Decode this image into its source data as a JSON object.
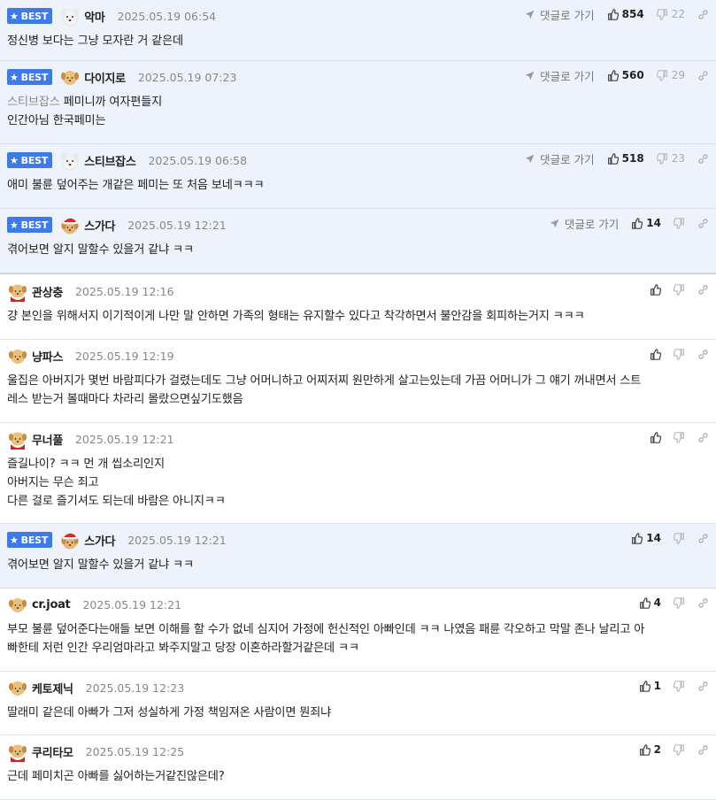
{
  "labels": {
    "best": "BEST",
    "reply_link": "댓글로 가기"
  },
  "colors": {
    "best_badge": "#3f7be6",
    "best_row_bg": "#eef3fb"
  },
  "comments": [
    {
      "best": true,
      "avatar": "white-dog",
      "nick": "악마",
      "date": "2025.05.19 06:54",
      "up": "854",
      "down": "22",
      "lines": [
        "정신병 보다는 그냥 모자란 거 같은데"
      ]
    },
    {
      "best": true,
      "avatar": "golden-dog",
      "nick": "다이지로",
      "date": "2025.05.19 07:23",
      "up": "560",
      "down": "29",
      "mention": "스티브잡스",
      "lines": [
        " 페미니까 여자편들지",
        "인간아님 한국페미는"
      ]
    },
    {
      "best": true,
      "avatar": "white-dog",
      "nick": "스티브잡스",
      "date": "2025.05.19 06:58",
      "up": "518",
      "down": "23",
      "lines": [
        "애미 불륜 덮어주는 개같은 페미는 또 처음 보네ㅋㅋㅋ"
      ]
    },
    {
      "best": true,
      "avatar": "santa-dog",
      "nick": "스가다",
      "date": "2025.05.19 12:21",
      "up": "14",
      "down": "",
      "lines": [
        "겪어보면 알지 말할수 있을거 같냐 ㅋㅋ"
      ]
    },
    {
      "best": false,
      "avatar": "cape-dog",
      "nick": "관상충",
      "date": "2025.05.19 12:16",
      "up": "",
      "down": "",
      "lines": [
        "걍 본인을 위해서지 이기적이게 나만 말 안하면 가족의 형태는 유지할수 있다고 착각하면서 불안감을 회피하는거지 ㅋㅋㅋ"
      ]
    },
    {
      "best": false,
      "avatar": "golden-dog",
      "nick": "냥파스",
      "date": "2025.05.19 12:19",
      "up": "",
      "down": "",
      "lines": [
        "울집은 아버지가 몇번 바람피다가 걸렸는데도 그냥 어머니하고 어찌저찌 원만하게 살고는있는데 가끔 어머니가 그 얘기 꺼내면서 스트",
        "레스 받는거 볼때마다 차라리 몰랐으면싶기도했음"
      ]
    },
    {
      "best": false,
      "avatar": "cape-dog",
      "nick": "무너풀",
      "date": "2025.05.19 12:21",
      "up": "",
      "down": "",
      "lines": [
        "즐길나이? ㅋㅋ 먼 개 씹소리인지",
        "아버지는 무슨 죄고",
        "다른 걸로 즐기셔도 되는데 바람은 아니지ㅋㅋ"
      ]
    },
    {
      "best": true,
      "avatar": "santa-dog",
      "nick": "스가다",
      "date": "2025.05.19 12:21",
      "up": "14",
      "down": "",
      "lines": [
        "겪어보면 알지 말할수 있을거 같냐 ㅋㅋ"
      ]
    },
    {
      "best": false,
      "avatar": "golden-dog",
      "nick": "cr.joat",
      "date": "2025.05.19 12:21",
      "up": "4",
      "down": "",
      "lines": [
        "부모 불륜 덮어준다는애들 보면 이해를 할 수가 없네 심지어 가정에 헌신적인 아빠인데 ㅋㅋ 나였음 패륜 각오하고 막말 존나 날리고 아",
        "빠한테 저런 인간 우리엄마라고 봐주지말고 당장 이혼하라할거같은데 ㅋㅋ"
      ]
    },
    {
      "best": false,
      "avatar": "golden-dog",
      "nick": "케토제닉",
      "date": "2025.05.19 12:23",
      "up": "1",
      "down": "",
      "lines": [
        "딸래미 같은데 아빠가 그저 성실하게 가정 책임져온 사람이면 뭔죄냐"
      ]
    },
    {
      "best": false,
      "avatar": "cape-dog",
      "nick": "쿠리타모",
      "date": "2025.05.19 12:25",
      "up": "2",
      "down": "",
      "lines": [
        "근데 페미치곤 아빠를 싫어하는거같진않은데?"
      ]
    }
  ]
}
